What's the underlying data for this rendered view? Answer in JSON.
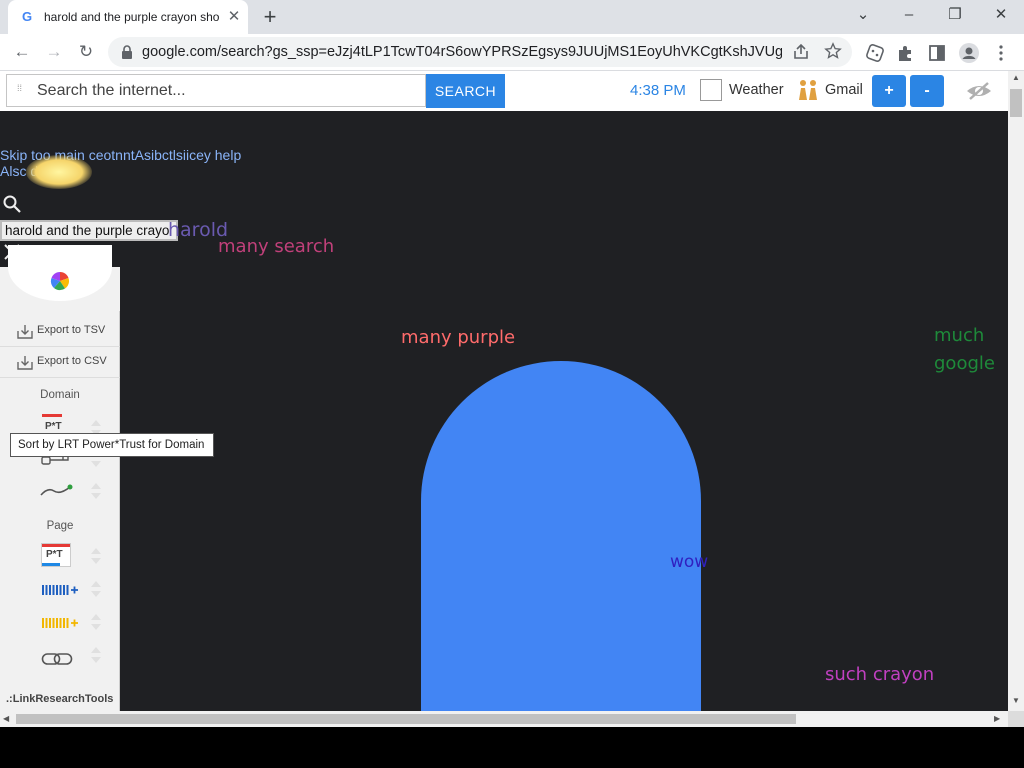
{
  "browser": {
    "tab_title": "harold and the purple crayon sho",
    "tab_favicon": "G",
    "tab_close": "✕",
    "new_tab": "+",
    "window_controls": {
      "minimize": "–",
      "maximize": "❐",
      "close": "✕",
      "menu": "⌄"
    },
    "url": "google.com/search?gs_ssp=eJzj4tLP1TcwT04rS6owYPRSzEgsys9JUUjMS1EoyUhVKCgtKshJVUguSqzMz...",
    "nav": {
      "back": "←",
      "forward": "→",
      "reload": "↻"
    },
    "toolbar_icons": [
      "share-icon",
      "star-icon",
      "extension-dice-icon",
      "puzzle-icon",
      "side-panel-icon",
      "profile-icon",
      "kebab-menu-icon"
    ]
  },
  "extension_bar": {
    "search_placeholder": "Search the internet...",
    "search_button": "SEARCH",
    "time": "4:38 PM",
    "weather_label": "Weather",
    "gmail_label": "Gmail",
    "zoom_in": "+",
    "zoom_out": "-"
  },
  "page": {
    "skip_link": "Skip too main ceotnntAsibctlsiicey help",
    "a11y_link": "Alsc           dacbek",
    "query_text": "harold and the purple crayo",
    "ghost_text": "harold",
    "doge_phrases": [
      {
        "text": "wow",
        "color": "#7fa832"
      },
      {
        "text": "many search",
        "color": "#c0407a"
      },
      {
        "text": "many purple",
        "color": "#ff6b6b"
      },
      {
        "text": "much",
        "color": "#1e8a3a"
      },
      {
        "text": "google",
        "color": "#1e8a3a"
      },
      {
        "text": "wow",
        "color": "#3020c0"
      },
      {
        "text": "such crayon",
        "color": "#c040c0"
      }
    ],
    "arch_color": "#4285f4",
    "background_color": "#1f2023"
  },
  "lrt_sidebar": {
    "export_tsv": "Export to TSV",
    "export_csv": "Export to CSV",
    "domain_heading": "Domain",
    "page_heading": "Page",
    "pt_badge": "P*T",
    "brand": ".:LinkResearchTools",
    "tooltip": "Sort by LRT Power*Trust for Domain"
  }
}
